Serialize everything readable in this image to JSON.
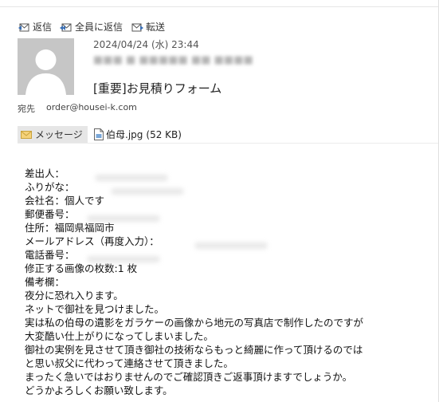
{
  "toolbar": {
    "reply": "返信",
    "reply_all": "全員に返信",
    "forward": "転送"
  },
  "message": {
    "date": "2024/04/24 (水) 23:44",
    "subject": "[重要]お見積りフォーム",
    "to_label": "宛先",
    "to_address": "order@housei-k.com"
  },
  "attachments": {
    "message_tab": "メッセージ",
    "file_name": "伯母.jpg",
    "file_size": "(52 KB)"
  },
  "body_lines": [
    "差出人：",
    "ふりがな：",
    "会社名：個人です",
    "郵便番号：",
    "住所：福岡県福岡市",
    "メールアドレス（再度入力）：",
    "電話番号：",
    "修正する画像の枚数:1 枚",
    "備考欄：",
    "夜分に恐れ入ります。",
    "ネットで御社を見つけました。",
    "実は私の伯母の遺影をガラケーの画像から地元の写真店で制作したのですが",
    "大変酷い仕上がりになってしまいました。",
    "御社の実例を見させて頂き御社の技術ならもっと綺麗に作って頂けるのでは",
    "と思い叔父に代わって連絡させて頂きました。",
    "まったく急いではおりませんのでご確認頂きご返事頂けますでしょうか。",
    "どうかよろしくお願い致します。"
  ]
}
